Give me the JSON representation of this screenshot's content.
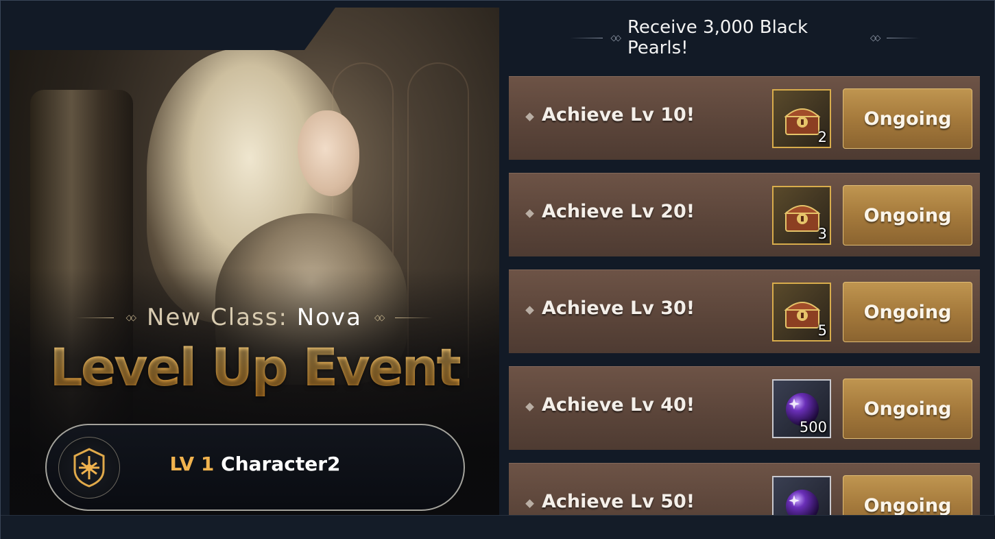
{
  "banner": {
    "subtitle_prefix": "New Class:",
    "subtitle_class": "Nova",
    "title": "Level Up Event",
    "character": {
      "level": "LV 1",
      "name": "Character2",
      "emblem_icon": "class-crest-icon"
    }
  },
  "panel": {
    "header": "Receive 3,000 Black Pearls!",
    "missions": [
      {
        "label": "Achieve Lv 10!",
        "reward_icon": "treasure-chest-icon",
        "reward_qty": "2",
        "status": "Ongoing"
      },
      {
        "label": "Achieve Lv 20!",
        "reward_icon": "treasure-chest-icon",
        "reward_qty": "3",
        "status": "Ongoing"
      },
      {
        "label": "Achieve Lv 30!",
        "reward_icon": "treasure-chest-icon",
        "reward_qty": "5",
        "status": "Ongoing"
      },
      {
        "label": "Achieve Lv 40!",
        "reward_icon": "black-pearl-icon",
        "reward_qty": "500",
        "status": "Ongoing"
      },
      {
        "label": "Achieve Lv 50!",
        "reward_icon": "black-pearl-icon",
        "reward_qty": "",
        "status": "Ongoing"
      }
    ]
  },
  "colors": {
    "accent_gold": "#f0b24e",
    "row_bg": "#5a4439",
    "button_gold": "#a57a3c",
    "background": "#121a26"
  }
}
